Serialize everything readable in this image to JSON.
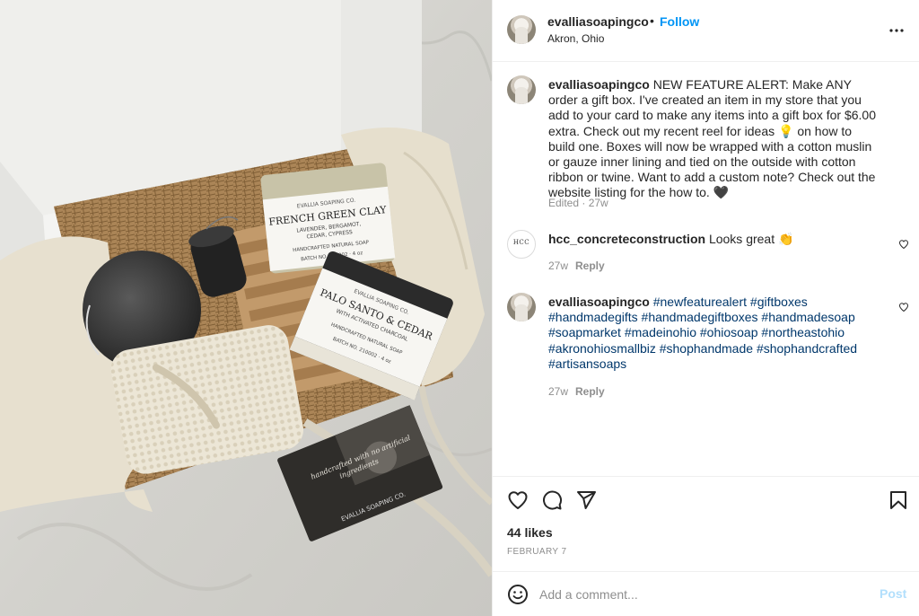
{
  "post": {
    "username": "evalliasoapingco",
    "separator": "•",
    "follow_label": "Follow",
    "location": "Akron, Ohio"
  },
  "photo": {
    "soap1": {
      "brand": "EVALLIA SOAPING CO.",
      "name": "FRENCH GREEN CLAY",
      "scents": "LAVENDER, BERGAMOT,",
      "scents2": "CEDAR, CYPRESS",
      "type": "HANDCRAFTED NATURAL SOAP",
      "batch": "BATCH NO. 210002 · 4 oz"
    },
    "soap2": {
      "brand": "EVALLIA SOAPING CO.",
      "name": "PALO SANTO & CEDAR",
      "sub": "WITH ACTIVATED CHARCOAL",
      "type": "HANDCRAFTED NATURAL SOAP",
      "batch": "BATCH NO. 210002 · 4 oz"
    },
    "card": {
      "script1": "handcrafted with no artificial",
      "script2": "ingredients",
      "brand": "EVALLIA SOAPING CO."
    }
  },
  "caption": {
    "username": "evalliasoapingco",
    "text": " NEW FEATURE ALERT: Make ANY order a gift box. I've created an item in my store that you add to your card to make any items into a gift box for $6.00 extra. Check out my recent reel for ideas 💡 on how to build one. Boxes will now be wrapped with a cotton muslin or gauze inner lining and tied on the outside with cotton ribbon or twine. Want to add a custom note? Check out the website listing for the how to. 🖤",
    "meta": "Edited · 27w"
  },
  "comments": [
    {
      "username": "hcc_concreteconstruction",
      "text": " Looks great 👏",
      "time": "27w",
      "reply": "Reply",
      "avatar_text": "HCC"
    },
    {
      "username": "evalliasoapingco",
      "tags": [
        "#newfeaturealert",
        "#giftboxes",
        "#handmadegifts",
        "#handmadegiftboxes",
        "#handmadesoap",
        "#soapmarket",
        "#madeinohio",
        "#ohiosoap",
        "#northeastohio",
        "#akronohiosmallbiz",
        "#shophandmade",
        "#shophandcrafted",
        "#artisansoaps"
      ],
      "time": "27w",
      "reply": "Reply"
    }
  ],
  "actions": {
    "icons": [
      "heart-icon",
      "comment-icon",
      "share-icon",
      "bookmark-icon"
    ],
    "likes": "44 likes",
    "date": "FEBRUARY 7"
  },
  "add_comment": {
    "placeholder": "Add a comment...",
    "post_label": "Post"
  },
  "colors": {
    "link": "#0095f6",
    "hashtag": "#00376b",
    "muted": "#8e8e8e",
    "text": "#262626",
    "post_disabled": "#b2dffc"
  }
}
